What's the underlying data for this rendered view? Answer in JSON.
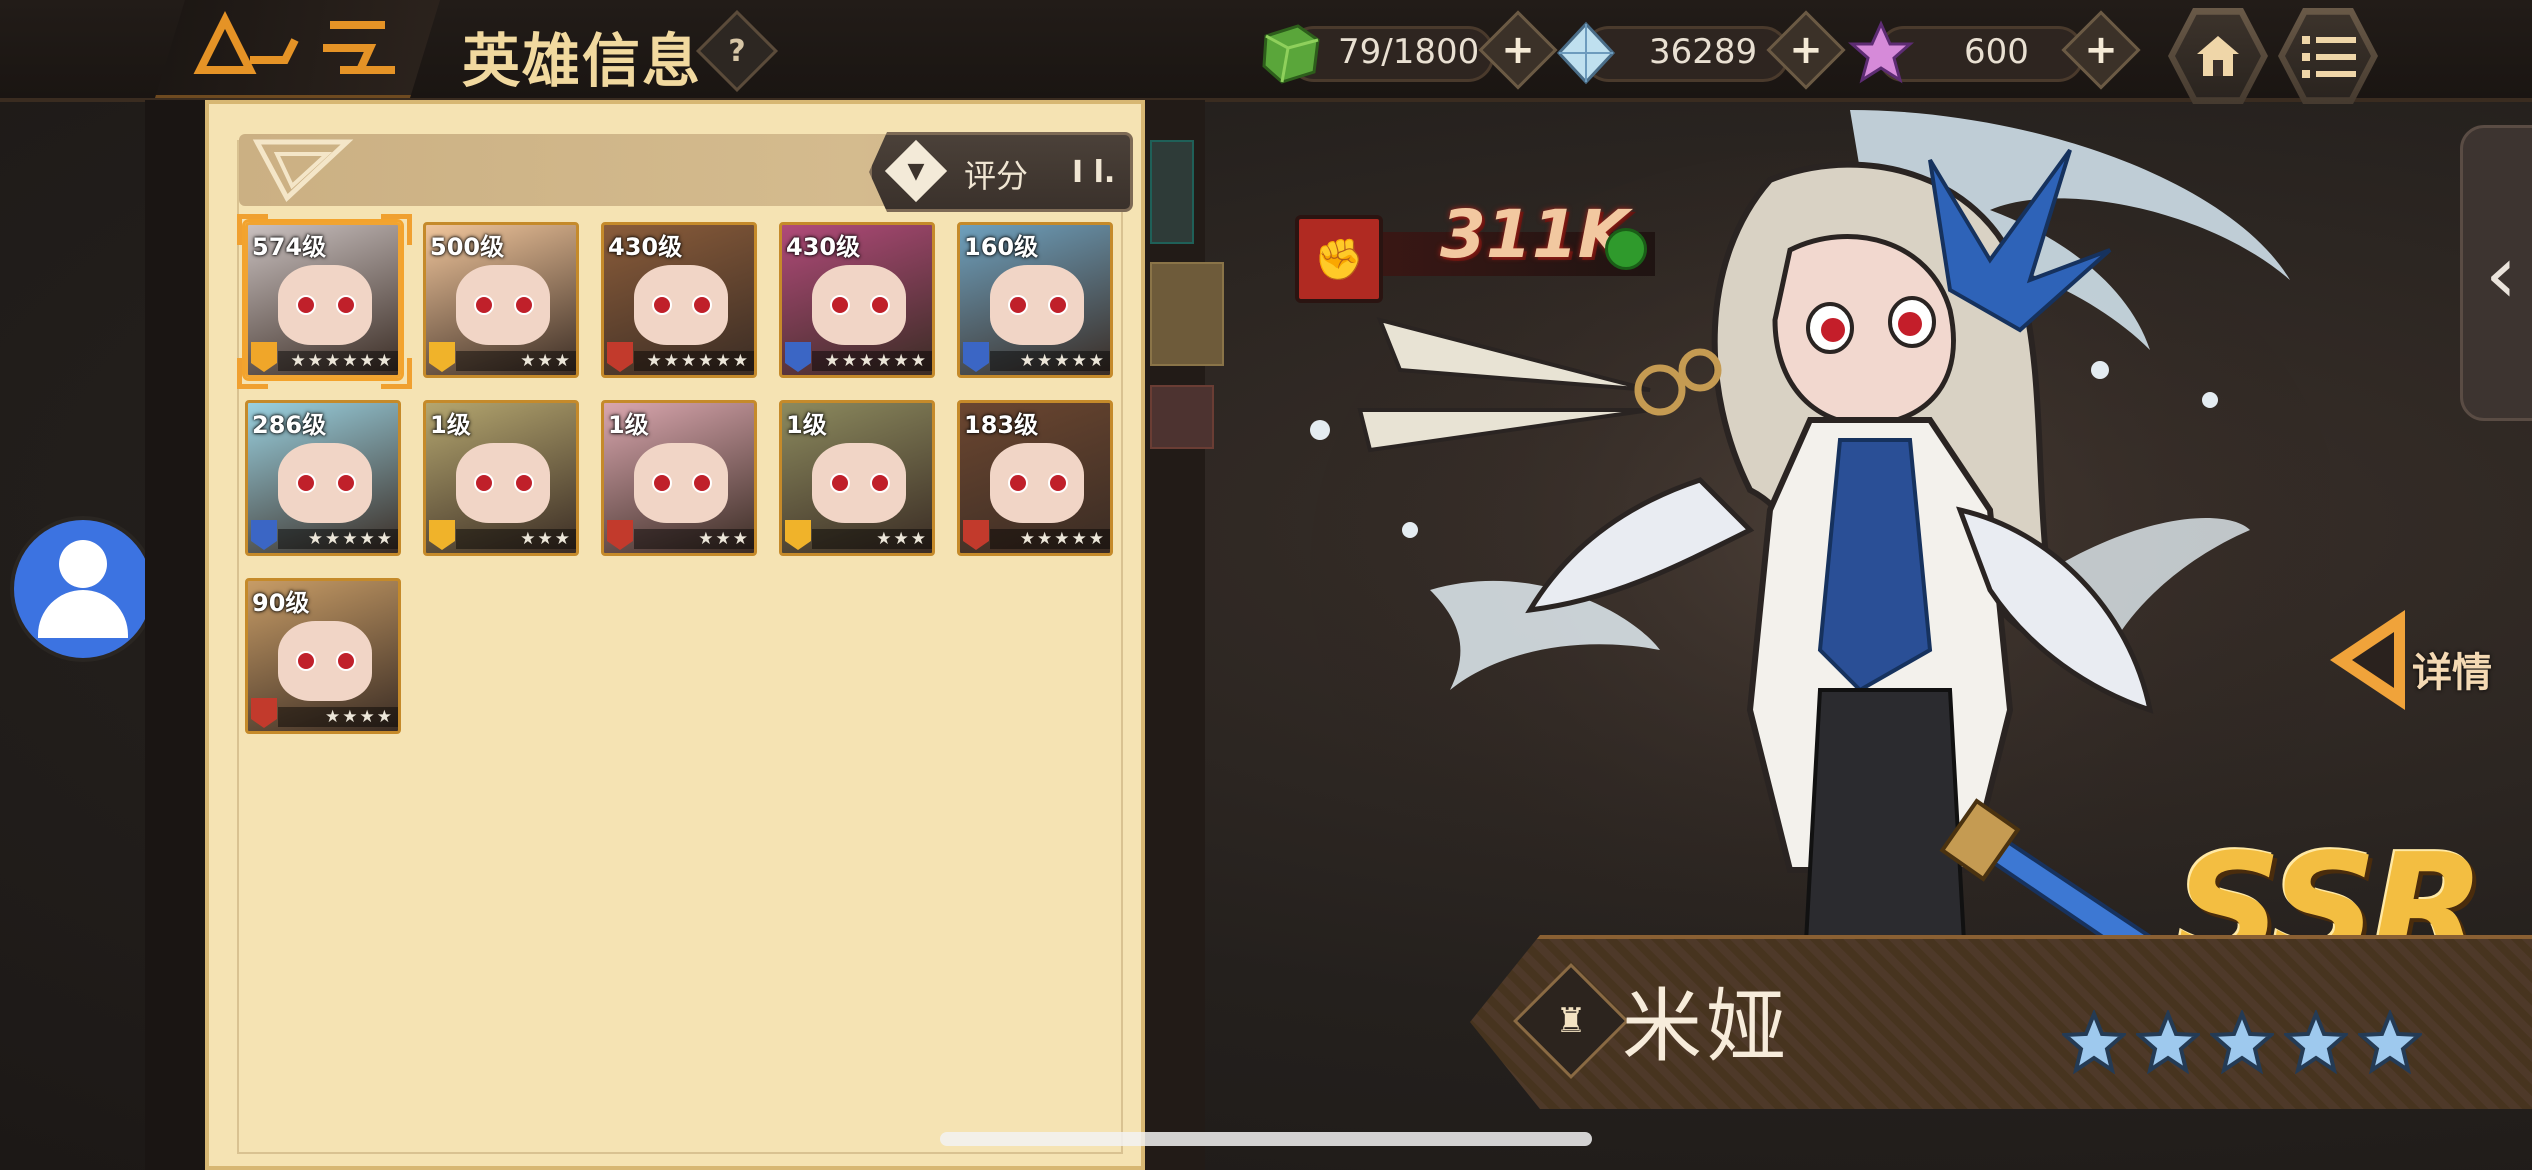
{
  "header": {
    "title": "英雄信息",
    "help_label": "?"
  },
  "resources": [
    {
      "name": "stamina",
      "value": "79/1800",
      "plus": "+"
    },
    {
      "name": "diamond",
      "value": "36289",
      "plus": "+"
    },
    {
      "name": "crystal",
      "value": "600",
      "plus": "+"
    }
  ],
  "panel": {
    "filter_label": "评分",
    "sort_icon": "Ⅰ‍l.",
    "heroes": [
      {
        "level": "574级",
        "stars": 6,
        "bg": "#c9c0bf",
        "badge": "#f0a629",
        "selected": true
      },
      {
        "level": "500级",
        "stars": 3,
        "bg": "#f0c59b",
        "badge": "#f0b32a",
        "selected": false
      },
      {
        "level": "430级",
        "stars": 6,
        "bg": "#8a5c3a",
        "badge": "#c23a2c",
        "selected": false
      },
      {
        "level": "430级",
        "stars": 6,
        "bg": "#b04a79",
        "badge": "#3b66c5",
        "selected": false
      },
      {
        "level": "160级",
        "stars": 5,
        "bg": "#6ea0bd",
        "badge": "#3b66c5",
        "selected": false
      },
      {
        "level": "286级",
        "stars": 5,
        "bg": "#9ad1e0",
        "badge": "#3b66c5",
        "selected": false
      },
      {
        "level": "1级",
        "stars": 3,
        "bg": "#b4a66f",
        "badge": "#f0b32a",
        "selected": false
      },
      {
        "level": "1级",
        "stars": 3,
        "bg": "#d9a6ae",
        "badge": "#c23a2c",
        "selected": false
      },
      {
        "level": "1级",
        "stars": 3,
        "bg": "#8c8a5e",
        "badge": "#f0b32a",
        "selected": false
      },
      {
        "level": "183级",
        "stars": 5,
        "bg": "#6b4630",
        "badge": "#c23a2c",
        "selected": false
      },
      {
        "level": "90级",
        "stars": 4,
        "bg": "#c79c66",
        "badge": "#c23a2c",
        "selected": false
      }
    ]
  },
  "hero": {
    "power": "311K",
    "name": "米娅",
    "rarity": "SSR",
    "star_count": 5,
    "detail_label": "详情"
  },
  "icons": {
    "home": "home-icon",
    "menu": "menu-icon",
    "filter": "filter-icon",
    "back": "chevron-left-icon",
    "avatar": "avatar-icon"
  },
  "colors": {
    "accent": "#f0a33a",
    "panel": "#f5e3b3",
    "power": "#b02a22"
  }
}
